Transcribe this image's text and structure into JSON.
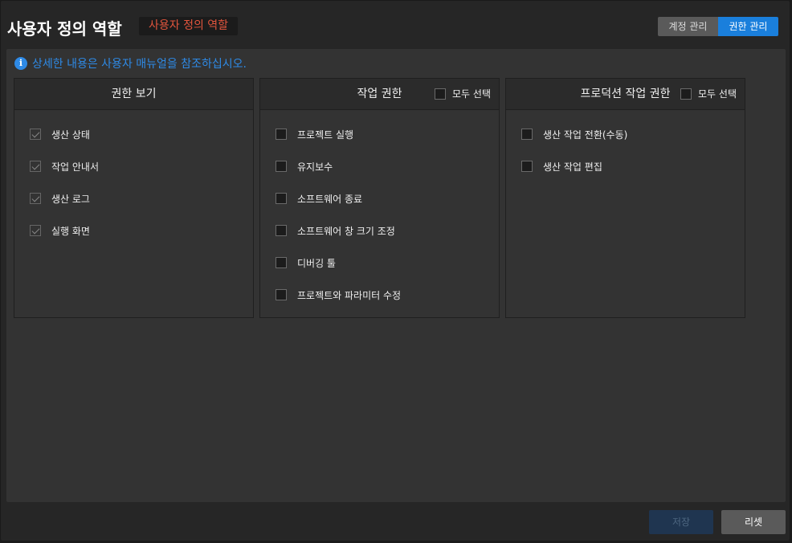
{
  "header": {
    "title": "사용자 정의 역할",
    "badge": "사용자 정의 역할",
    "tabs": [
      {
        "label": "계정 관리",
        "active": false
      },
      {
        "label": "권한 관리",
        "active": true
      }
    ]
  },
  "info": {
    "icon": "info-icon",
    "text": "상세한 내용은 사용자 매뉴얼을 참조하십시오."
  },
  "columns": [
    {
      "title": "권한 보기",
      "select_all": null,
      "items": [
        {
          "label": "생산 상태",
          "checked": true
        },
        {
          "label": "작업 안내서",
          "checked": true
        },
        {
          "label": "생산 로그",
          "checked": true
        },
        {
          "label": "실행 화면",
          "checked": true
        }
      ]
    },
    {
      "title": "작업 권한",
      "select_all": "모두 선택",
      "items": [
        {
          "label": "프로젝트 실행",
          "checked": false
        },
        {
          "label": "유지보수",
          "checked": false
        },
        {
          "label": "소프트웨어 종료",
          "checked": false
        },
        {
          "label": "소프트웨어 창 크기 조정",
          "checked": false
        },
        {
          "label": "디버깅 툴",
          "checked": false
        },
        {
          "label": "프로젝트와 파라미터 수정",
          "checked": false
        }
      ]
    },
    {
      "title": "프로덕션 작업 권한",
      "select_all": "모두 선택",
      "items": [
        {
          "label": "생산 작업 전환(수동)",
          "checked": false
        },
        {
          "label": "생산 작업 편집",
          "checked": false
        }
      ]
    }
  ],
  "footer": {
    "save": "저장",
    "reset": "리셋"
  },
  "colors": {
    "accent": "#1a7fdc",
    "badge_text": "#e2553d",
    "info": "#2e8ae6"
  }
}
